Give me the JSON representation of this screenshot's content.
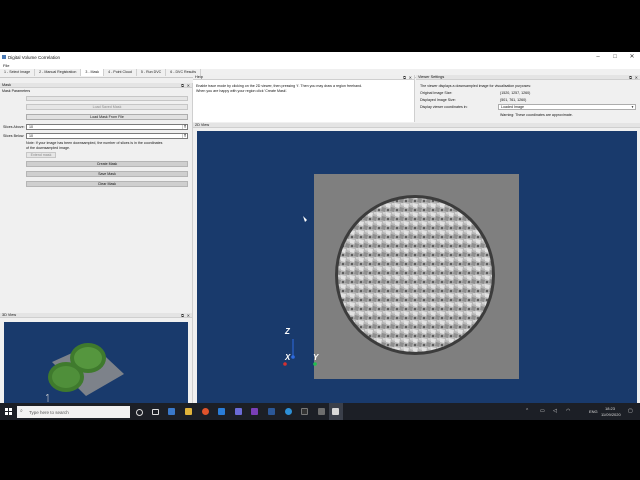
{
  "window": {
    "title": "Digital Volume Correlation",
    "minimize": "–",
    "maximize": "□",
    "close": "✕"
  },
  "menu": {
    "file": "File"
  },
  "tabs": [
    "1 - Select Image",
    "2 - Manual Registration",
    "3 - Mask",
    "4 - Point Cloud",
    "5 - Run DVC",
    "6 - DVC Results"
  ],
  "mask_panel": {
    "header": "Mask",
    "section_label": "Mask Parameters",
    "load_saved_mask": "Load Saved Mask",
    "load_mask_from_file": "Load Mask From File",
    "slices_above_label": "Slices Above:",
    "slices_above_value": "10",
    "slices_below_label": "Slices Below:",
    "slices_below_value": "10",
    "note": "Note: If your image has been downsampled, the number of slices is in the coordinates of the downsampled image.",
    "extend_mask": "Extend mask",
    "create_mask": "Create Mask",
    "save_mask": "Save Mask",
    "clear_mask": "Clear Mask"
  },
  "help_panel": {
    "header": "Help",
    "line1": "Enable trace mode by clicking on the 2D viewer, then pressing 't'. Then you may draw a region freehand.",
    "line2": "When you are happy with your region click 'Create Mask'."
  },
  "viewer_settings": {
    "header": "Viewer Settings",
    "info": "The viewer displays a downsampled image for visualisation purposes:",
    "original_size_label": "Original Image Size:",
    "original_size_value": "(1520, 1257, 1260)",
    "displayed_size_label": "Displayed Image Size:",
    "displayed_size_value": "(501, 761, 1260)",
    "coords_label": "Display viewer coordinates in:",
    "coords_value": "Loaded Image",
    "warning": "Warning: These coordinates are approximate."
  },
  "view2d": {
    "header": "2D View",
    "axis_x": "X",
    "axis_y": "Y",
    "axis_z": "Z"
  },
  "view3d": {
    "header": "3D View",
    "axis_label": "z"
  },
  "taskbar": {
    "search_placeholder": "Type here to search",
    "time": "18:23",
    "date": "11/09/2020",
    "lang": "ENG"
  },
  "colors": {
    "viewer_bg": "#193a6c",
    "taskbar_bg": "#1c1f26",
    "mask_green": "#3f7a2d"
  }
}
